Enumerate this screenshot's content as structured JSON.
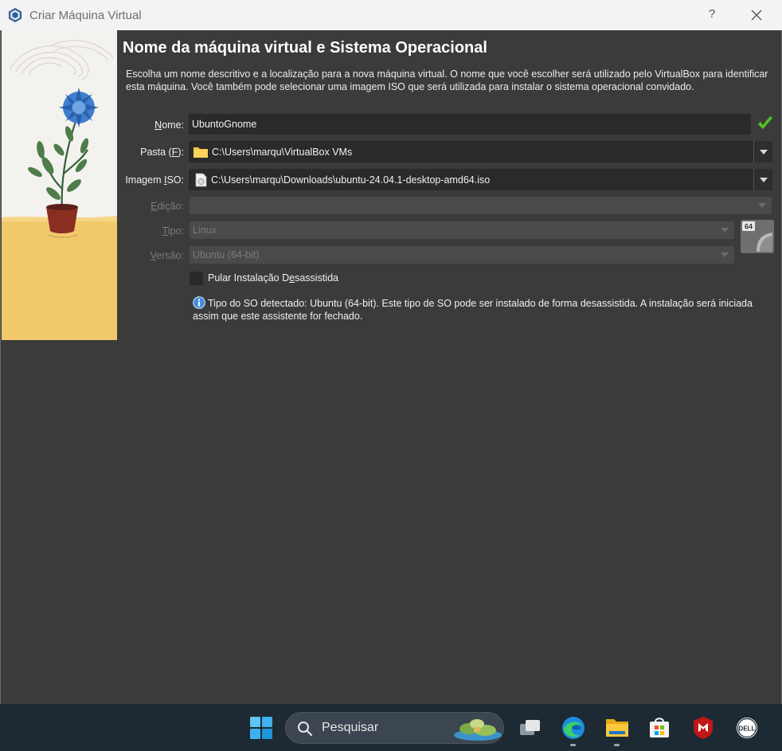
{
  "window": {
    "title": "Criar Máquina Virtual",
    "help_glyph": "?"
  },
  "page": {
    "heading": "Nome da máquina virtual e Sistema Operacional",
    "description": "Escolha um nome descritivo e a localização para a nova máquina virtual. O nome que você escolher será utilizado pelo VirtualBox para identificar esta máquina. Você também pode selecionar uma imagem ISO que será utilizada para instalar o sistema operacional convidado."
  },
  "form": {
    "name": {
      "label_pre": "",
      "label_key": "N",
      "label_post": "ome:",
      "value": "UbuntoGnome"
    },
    "folder": {
      "label_pre": "Pasta (",
      "label_key": "F",
      "label_post": "):",
      "value": "C:\\Users\\marqu\\VirtualBox VMs"
    },
    "iso": {
      "label_pre": "Imagem ",
      "label_key": "I",
      "label_post": "SO:",
      "value": "C:\\Users\\marqu\\Downloads\\ubuntu-24.04.1-desktop-amd64.iso"
    },
    "edition": {
      "label_pre": "",
      "label_key": "E",
      "label_post": "dição:",
      "value": ""
    },
    "type": {
      "label_pre": "",
      "label_key": "T",
      "label_post": "ipo:",
      "value": "Linux"
    },
    "version": {
      "label_pre": "",
      "label_key": "V",
      "label_post": "ersão:",
      "value": "Ubuntu (64-bit)"
    },
    "skip_unattended": {
      "label_pre": "Pular Instalação D",
      "label_key": "e",
      "label_post": "sassistida",
      "checked": false
    },
    "os_badge": "64",
    "info": "Tipo do SO detectado: Ubuntu (64-bit). Este tipo de SO pode ser instalado de forma desassistida. A instalação será iniciada assim que este assistente for fechado."
  },
  "taskbar": {
    "search_placeholder": "Pesquisar",
    "apps": [
      "start-icon",
      "task-view-icon",
      "edge-icon",
      "file-explorer-icon",
      "store-icon",
      "mcafee-icon",
      "dell-icon"
    ]
  },
  "colors": {
    "window_bg": "#3b3b3c",
    "field_bg": "#2a2a2b",
    "taskbar_bg": "#1e2a33",
    "valid_green": "#5fbf2f"
  }
}
